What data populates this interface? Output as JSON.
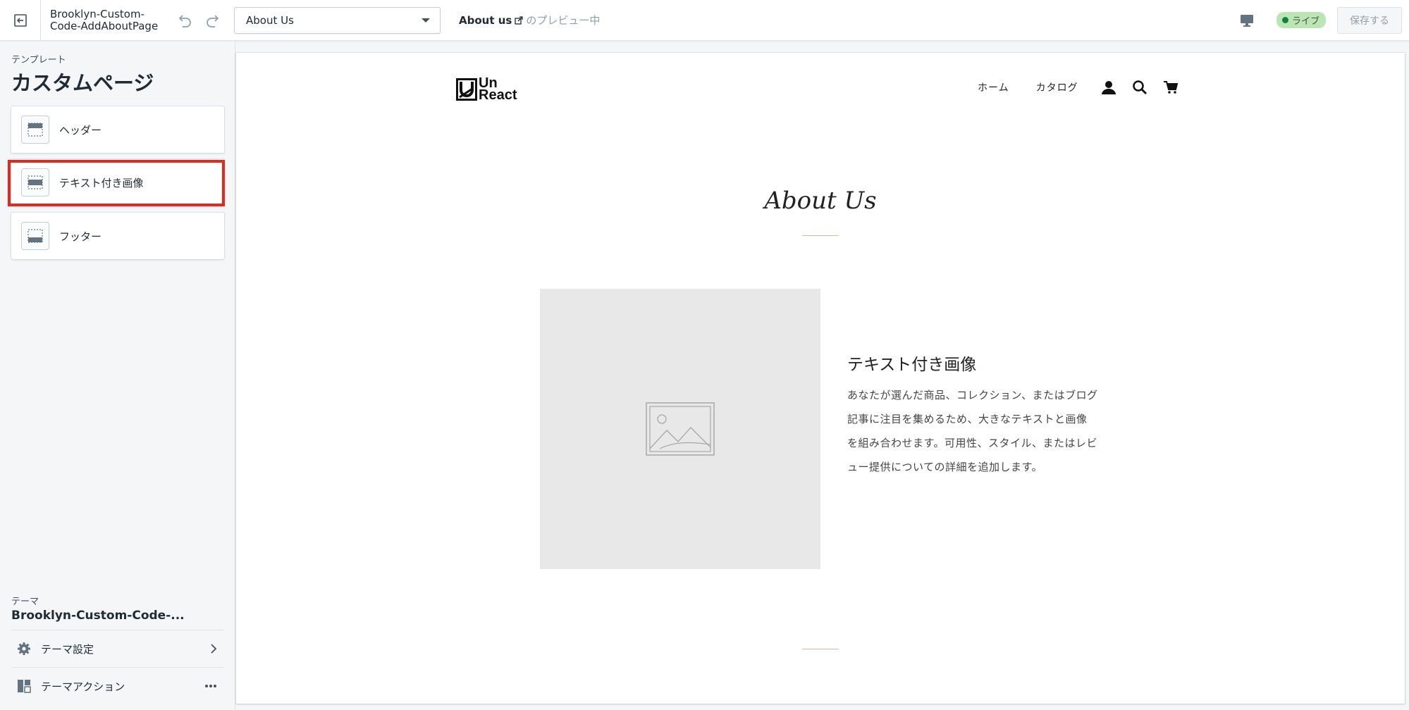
{
  "topbar": {
    "theme_title": "Brooklyn-Custom-Code-AddAboutPage",
    "page_select": "About Us",
    "preview_page": "About us",
    "preview_suffix": "のプレビュー中",
    "live_badge": "ライブ",
    "save_label": "保存する"
  },
  "sidebar": {
    "template_label": "テンプレート",
    "template_title": "カスタムページ",
    "sections": [
      {
        "label": "ヘッダー"
      },
      {
        "label": "テキスト付き画像"
      },
      {
        "label": "フッター"
      }
    ],
    "theme_label": "テーマ",
    "theme_name": "Brooklyn-Custom-Code-...",
    "menu": [
      {
        "label": "テーマ設定"
      },
      {
        "label": "テーマアクション"
      }
    ]
  },
  "store": {
    "logo_text_line1": "Un",
    "logo_text_line2": "React",
    "nav": [
      "ホーム",
      "カタログ"
    ],
    "heading": "About Us",
    "feature_title": "テキスト付き画像",
    "feature_body": "あなたが選んだ商品、コレクション、またはブログ記事に注目を集めるため、大きなテキストと画像を組み合わせます。可用性、スタイル、またはレビュー提供についての詳細を追加します。"
  },
  "colors": {
    "highlight": "#e8271c",
    "live_badge_bg": "#bbe5b3",
    "live_dot": "#108043",
    "accent_rule": "#d3b4a2"
  }
}
